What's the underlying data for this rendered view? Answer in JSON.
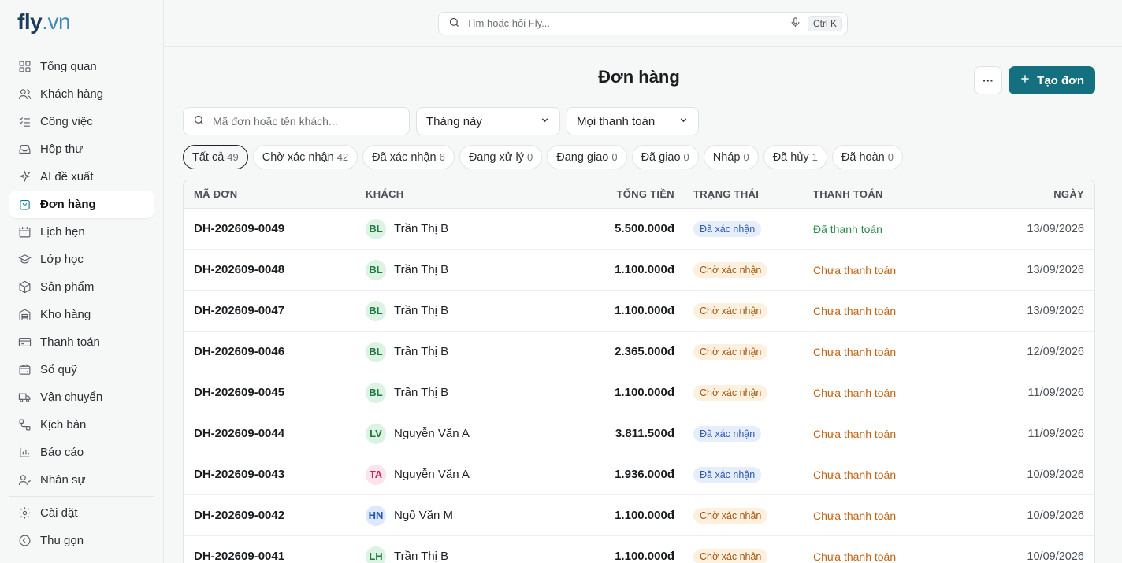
{
  "brand": {
    "part1": "fly",
    "part2": ".vn"
  },
  "search": {
    "placeholder": "Tìm hoặc hỏi Fly...",
    "shortcut": "Ctrl K"
  },
  "sidebar": {
    "items": [
      {
        "label": "Tổng quan",
        "icon": "grid-icon"
      },
      {
        "label": "Khách hàng",
        "icon": "users-icon"
      },
      {
        "label": "Công việc",
        "icon": "checklist-icon"
      },
      {
        "label": "Hộp thư",
        "icon": "inbox-icon"
      },
      {
        "label": "AI đề xuất",
        "icon": "sparkle-icon"
      },
      {
        "label": "Đơn hàng",
        "icon": "shopping-bag-icon",
        "active": true
      },
      {
        "label": "Lịch hẹn",
        "icon": "calendar-icon"
      },
      {
        "label": "Lớp học",
        "icon": "graduation-cap-icon"
      },
      {
        "label": "Sản phẩm",
        "icon": "box-icon"
      },
      {
        "label": "Kho hàng",
        "icon": "warehouse-icon"
      },
      {
        "label": "Thanh toán",
        "icon": "credit-card-icon"
      },
      {
        "label": "Sổ quỹ",
        "icon": "wallet-icon"
      },
      {
        "label": "Vận chuyển",
        "icon": "truck-icon"
      },
      {
        "label": "Kịch bản",
        "icon": "workflow-icon"
      },
      {
        "label": "Báo cáo",
        "icon": "bar-chart-icon"
      },
      {
        "label": "Nhân sự",
        "icon": "staff-icon"
      }
    ],
    "footer": [
      {
        "label": "Cài đặt",
        "icon": "gear-icon"
      },
      {
        "label": "Thu gọn",
        "icon": "collapse-icon"
      }
    ]
  },
  "page": {
    "title": "Đơn hàng",
    "more_label": "···",
    "create_label": "Tạo đơn"
  },
  "filters": {
    "search_placeholder": "Mã đơn hoặc tên khách...",
    "period": "Tháng này",
    "payment": "Mọi thanh toán"
  },
  "tabs": [
    {
      "label": "Tất cả",
      "count": "49",
      "active": true
    },
    {
      "label": "Chờ xác nhận",
      "count": "42"
    },
    {
      "label": "Đã xác nhận",
      "count": "6"
    },
    {
      "label": "Đang xử lý",
      "count": "0"
    },
    {
      "label": "Đang giao",
      "count": "0"
    },
    {
      "label": "Đã giao",
      "count": "0"
    },
    {
      "label": "Nháp",
      "count": "0"
    },
    {
      "label": "Đã hủy",
      "count": "1"
    },
    {
      "label": "Đã hoàn",
      "count": "0"
    }
  ],
  "table": {
    "headers": {
      "id": "MÃ ĐƠN",
      "customer": "KHÁCH",
      "total": "TỔNG TIỀN",
      "status": "TRẠNG THÁI",
      "payment": "THANH TOÁN",
      "date": "NGÀY"
    },
    "rows": [
      {
        "id": "DH-202609-0049",
        "initials": "BL",
        "avatar_color": "green",
        "customer": "Trần Thị B",
        "total": "5.500.000đ",
        "status": "Đã xác nhận",
        "status_type": "confirmed",
        "payment": "Đã thanh toán",
        "payment_type": "paid",
        "date": "13/09/2026"
      },
      {
        "id": "DH-202609-0048",
        "initials": "BL",
        "avatar_color": "green",
        "customer": "Trần Thị B",
        "total": "1.100.000đ",
        "status": "Chờ xác nhận",
        "status_type": "pending",
        "payment": "Chưa thanh toán",
        "payment_type": "unpaid",
        "date": "13/09/2026"
      },
      {
        "id": "DH-202609-0047",
        "initials": "BL",
        "avatar_color": "green",
        "customer": "Trần Thị B",
        "total": "1.100.000đ",
        "status": "Chờ xác nhận",
        "status_type": "pending",
        "payment": "Chưa thanh toán",
        "payment_type": "unpaid",
        "date": "13/09/2026"
      },
      {
        "id": "DH-202609-0046",
        "initials": "BL",
        "avatar_color": "green",
        "customer": "Trần Thị B",
        "total": "2.365.000đ",
        "status": "Chờ xác nhận",
        "status_type": "pending",
        "payment": "Chưa thanh toán",
        "payment_type": "unpaid",
        "date": "12/09/2026"
      },
      {
        "id": "DH-202609-0045",
        "initials": "BL",
        "avatar_color": "green",
        "customer": "Trần Thị B",
        "total": "1.100.000đ",
        "status": "Chờ xác nhận",
        "status_type": "pending",
        "payment": "Chưa thanh toán",
        "payment_type": "unpaid",
        "date": "11/09/2026"
      },
      {
        "id": "DH-202609-0044",
        "initials": "LV",
        "avatar_color": "green",
        "customer": "Nguyễn Văn A",
        "total": "3.811.500đ",
        "status": "Đã xác nhận",
        "status_type": "confirmed",
        "payment": "Chưa thanh toán",
        "payment_type": "unpaid",
        "date": "11/09/2026"
      },
      {
        "id": "DH-202609-0043",
        "initials": "TA",
        "avatar_color": "pink",
        "customer": "Nguyễn Văn A",
        "total": "1.936.000đ",
        "status": "Đã xác nhận",
        "status_type": "confirmed",
        "payment": "Chưa thanh toán",
        "payment_type": "unpaid",
        "date": "10/09/2026"
      },
      {
        "id": "DH-202609-0042",
        "initials": "HN",
        "avatar_color": "blue",
        "customer": "Ngô Văn M",
        "total": "1.100.000đ",
        "status": "Chờ xác nhận",
        "status_type": "pending",
        "payment": "Chưa thanh toán",
        "payment_type": "unpaid",
        "date": "10/09/2026"
      },
      {
        "id": "DH-202609-0041",
        "initials": "LH",
        "avatar_color": "green",
        "customer": "Trần Thị B",
        "total": "1.100.000đ",
        "status": "Chờ xác nhận",
        "status_type": "pending",
        "payment": "Chưa thanh toán",
        "payment_type": "unpaid",
        "date": "10/09/2026"
      }
    ]
  },
  "colors": {
    "accent": "#14707e",
    "avatar_green_bg": "#dcf3e4",
    "avatar_green_fg": "#1f7a43",
    "avatar_pink_bg": "#fde3ec",
    "avatar_pink_fg": "#c2255c",
    "avatar_blue_bg": "#dde8fb",
    "avatar_blue_fg": "#2457b8",
    "badge_confirmed_bg": "#e6edfb",
    "badge_confirmed_fg": "#2d59b5",
    "badge_pending_bg": "#fdf0de",
    "badge_pending_fg": "#a4540e",
    "pay_paid": "#2b8a4a",
    "pay_unpaid": "#c06414"
  }
}
